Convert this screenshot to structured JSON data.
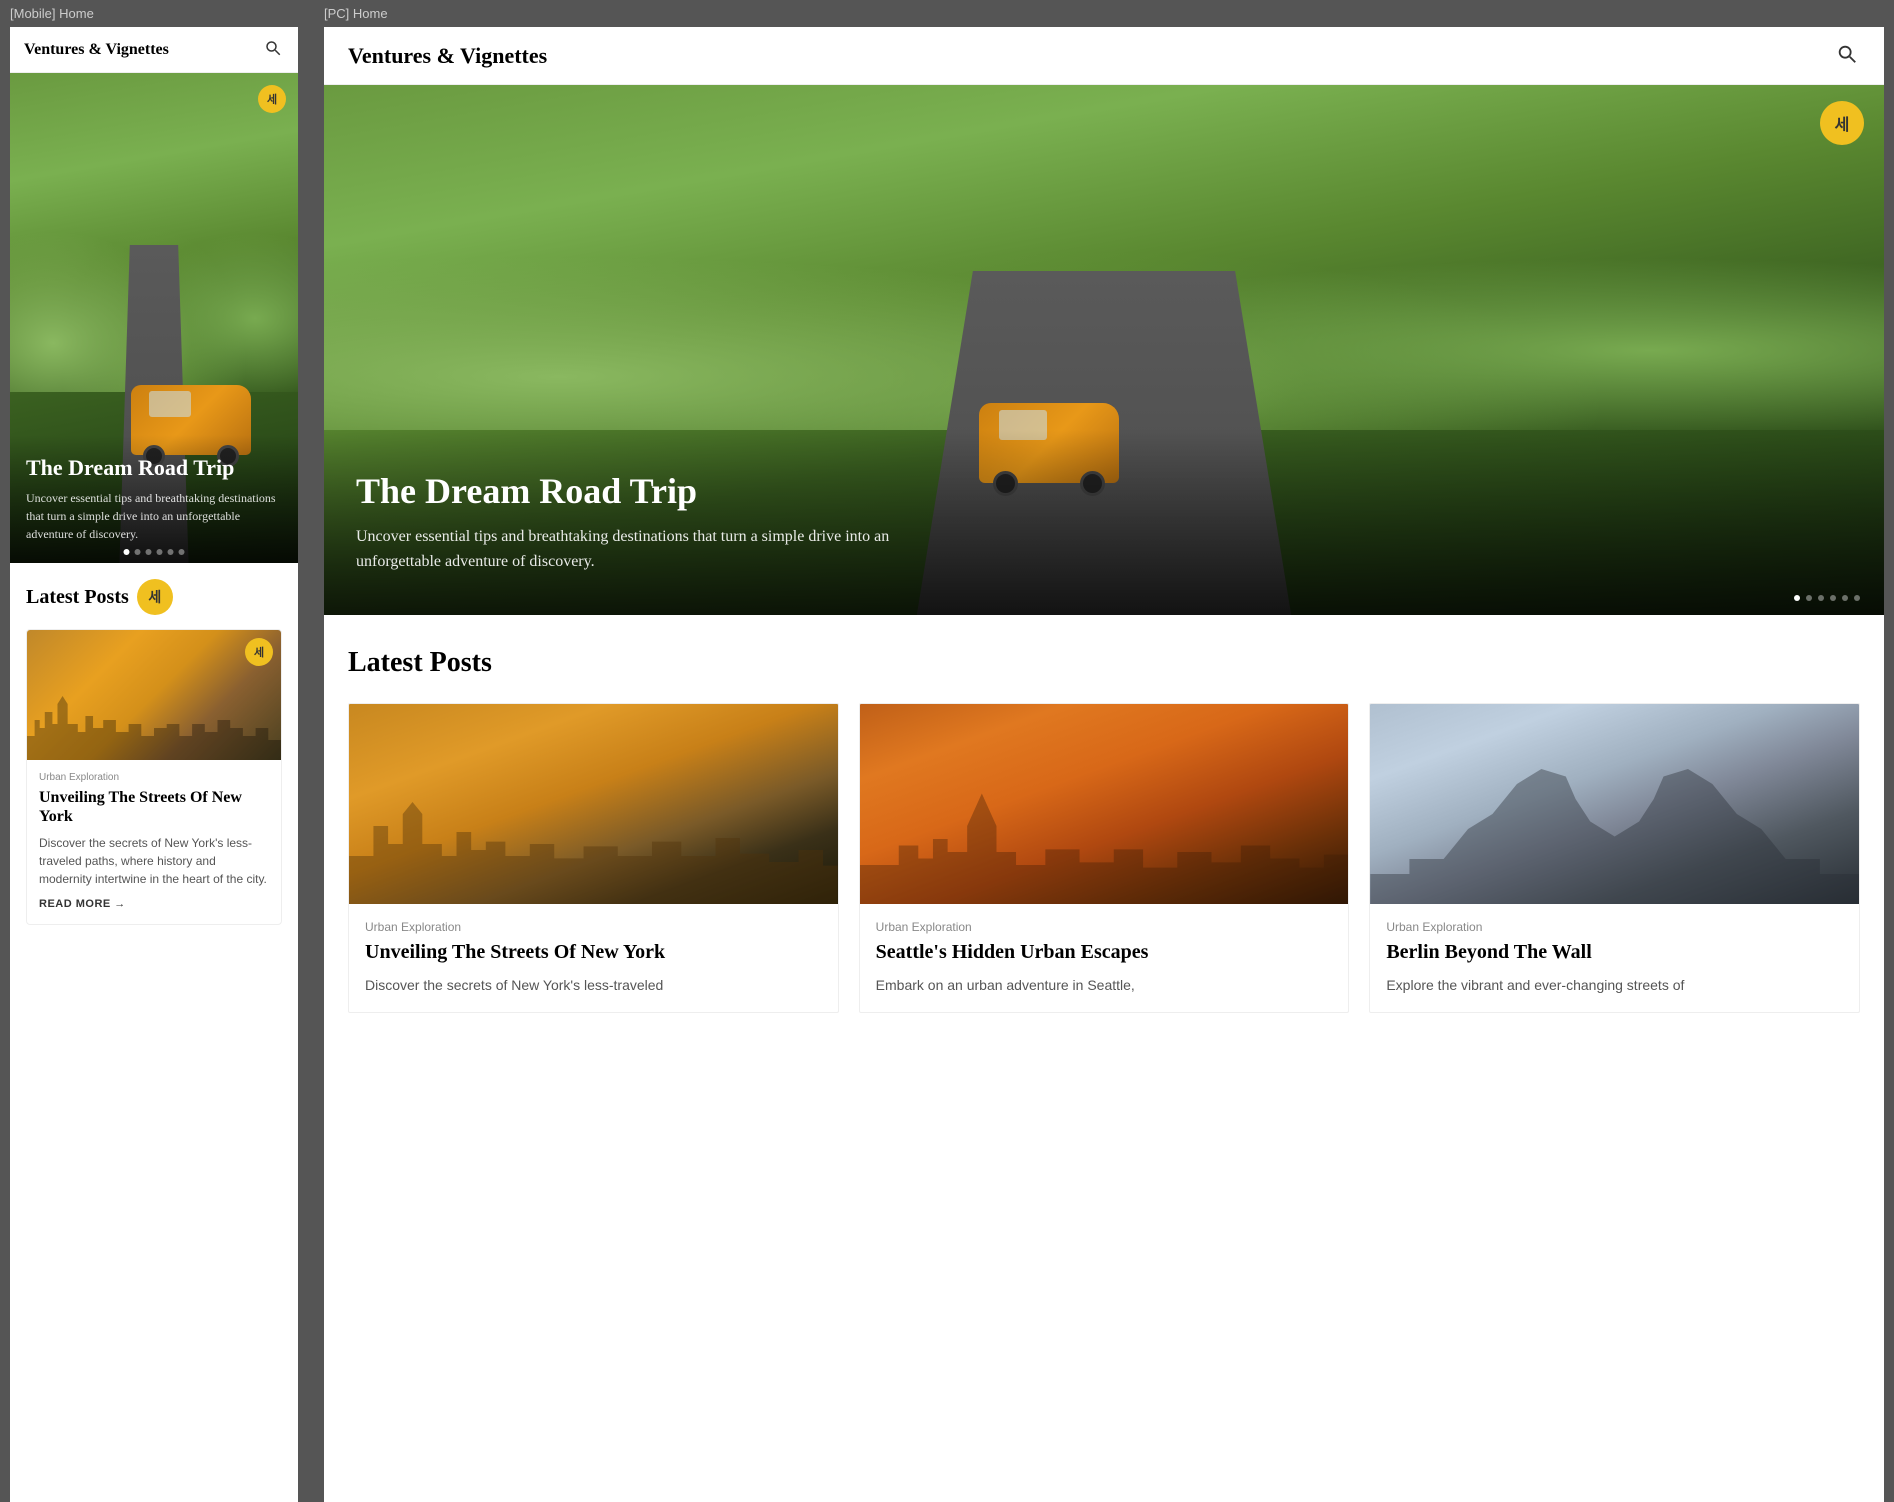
{
  "mobile": {
    "label": "[Mobile] Home",
    "header": {
      "title": "Ventures & Vignettes",
      "search_aria": "Search"
    },
    "hero": {
      "badge_char": "세",
      "title": "The Dream Road Trip",
      "description": "Uncover essential tips and breathtaking destinations that turn a simple drive into an unforgettable adventure of discovery.",
      "dots": [
        true,
        false,
        false,
        false,
        false,
        false
      ]
    },
    "latest": {
      "title": "Latest Posts",
      "badge_char": "세",
      "post": {
        "category": "Urban Exploration",
        "title": "Unveiling The Streets Of New York",
        "description": "Discover the secrets of New York's less-traveled paths, where history and modernity intertwine in the heart of the city.",
        "read_more": "READ MORE →",
        "badge_char": "세"
      }
    }
  },
  "pc": {
    "label": "[PC] Home",
    "header": {
      "title": "Ventures & Vignettes",
      "search_aria": "Search"
    },
    "hero": {
      "badge_char": "세",
      "title": "The Dream Road Trip",
      "description": "Uncover essential tips and breathtaking destinations that turn a simple drive into an unforgettable adventure of discovery.",
      "dots": [
        false,
        false,
        false,
        false,
        false,
        false
      ]
    },
    "latest": {
      "title": "Latest Posts",
      "posts": [
        {
          "id": "ny",
          "category": "Urban Exploration",
          "title": "Unveiling The Streets Of New York",
          "description": "Discover the secrets of New York's less-traveled"
        },
        {
          "id": "seattle",
          "category": "Urban Exploration",
          "title": "Seattle's Hidden Urban Escapes",
          "description": "Embark on an urban adventure in Seattle,"
        },
        {
          "id": "berlin",
          "category": "Urban Exploration",
          "title": "Berlin Beyond The Wall",
          "description": "Explore the vibrant and ever-changing streets of"
        }
      ]
    }
  }
}
